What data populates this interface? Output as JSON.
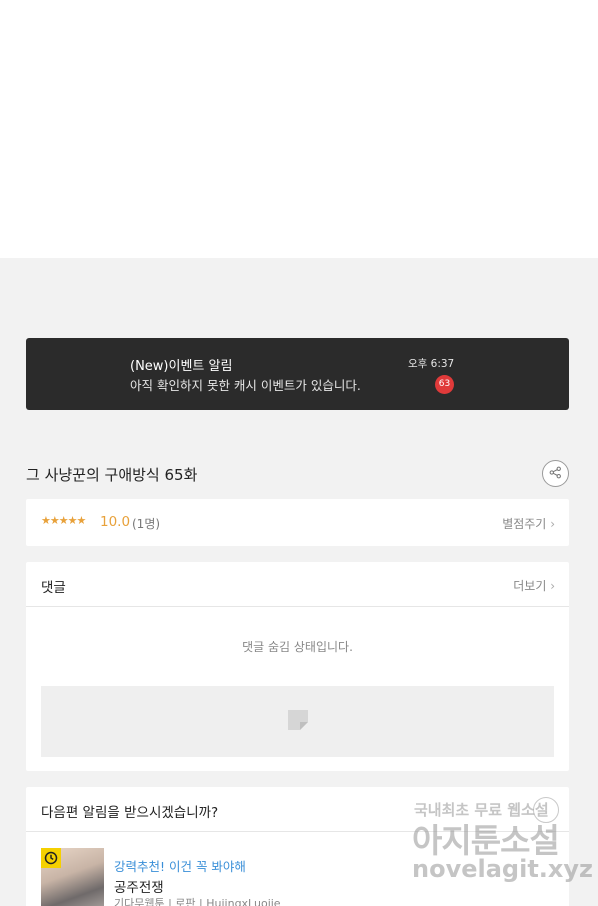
{
  "notification": {
    "title": "(New)이벤트 알림",
    "body": "아직 확인하지 못한 캐시 이벤트가 있습니다.",
    "time": "오후 6:37",
    "count": "63"
  },
  "episode": {
    "title": "그 사냥꾼의 구애방식 65화",
    "share_icon": "share-icon"
  },
  "rating": {
    "stars": "★★★★★",
    "score": "10.0",
    "votes": "(1명)",
    "rate_label": "별점주기"
  },
  "comments": {
    "label": "댓글",
    "more_label": "더보기",
    "hidden_message": "댓글 숨김 상태입니다."
  },
  "next_episode": {
    "label": "다음편 알림을 받으시겠습니까?",
    "recommend_title": "강력추천! 이건 꼭 봐야해",
    "work_title": "공주전쟁",
    "work_meta": "기다무웹툰 | 로판 | HuiingxLuojie"
  },
  "watermark": {
    "line1": "국내최초 무료 웹소설",
    "line2": "아지툰소설",
    "line3": "novelagit.xyz"
  },
  "colors": {
    "accent_orange": "#e8a13a",
    "notification_bg": "#2b2b2b",
    "badge_red": "#e03a3a",
    "link_blue": "#3a8fd8"
  }
}
